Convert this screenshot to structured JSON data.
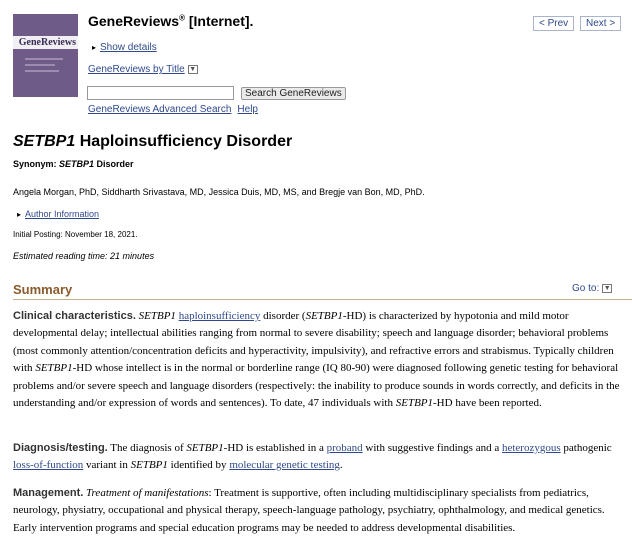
{
  "header": {
    "book_title": "GeneReviews",
    "book_title_sup": "®",
    "book_title_suffix": " [Internet].",
    "cover_title": "GeneReviews",
    "prev_label": "< Prev",
    "next_label": "Next >",
    "show_details": "Show details",
    "by_title": "GeneReviews by Title",
    "search_value": "",
    "search_button": "Search GeneReviews",
    "advanced_search": "GeneReviews Advanced Search",
    "help": "Help"
  },
  "chapter": {
    "title_gene": "SETBP1",
    "title_rest": " Haploinsufficiency Disorder",
    "synonym_label": "Synonym: ",
    "synonym_value": "SETBP1",
    "synonym_rest": " Disorder",
    "authors": "Angela Morgan, PhD, Siddharth Srivastava, MD, Jessica Duis, MD, MS, and Bregje van Bon, MD, PhD.",
    "author_info": "Author Information",
    "posting": "Initial Posting: November 18, 2021.",
    "reading_time": "Estimated reading time: 21 minutes"
  },
  "summary": {
    "heading": "Summary",
    "goto": "Go to:",
    "clinical_label": "Clinical characteristics.",
    "clinical_gene": "SETBP1",
    "clinical_link": "haploinsufficiency",
    "clinical_t1": " disorder (",
    "clinical_gene2": "SETBP1",
    "clinical_t2": "-HD) is characterized by hypotonia and mild motor developmental delay; intellectual abilities ranging from normal to severe disability; speech and language disorder; behavioral problems (most commonly attention/concentration deficits and hyperactivity, impulsivity), and refractive errors and strabismus. Typically children with ",
    "clinical_gene3": "SETBP1",
    "clinical_t3": "-HD whose intellect is in the normal or borderline range (IQ 80-90) were diagnosed following genetic testing for behavioral problems and/or severe speech and language disorders (respectively: the inability to produce sounds in words correctly, and deficits in the understanding and/or expression of words and sentences). To date, 47 individuals with ",
    "clinical_gene4": "SETBP1",
    "clinical_t4": "-HD have been reported.",
    "diag_label": "Diagnosis/testing.",
    "diag_t1": " The diagnosis of ",
    "diag_gene": "SETBP1",
    "diag_t2": "-HD is established in a ",
    "diag_link1": "proband",
    "diag_t3": " with suggestive findings and a ",
    "diag_link2": "heterozygous",
    "diag_t4": " pathogenic ",
    "diag_link3": "loss-of-function",
    "diag_t5": " variant in ",
    "diag_gene2": "SETBP1",
    "diag_t6": " identified by ",
    "diag_link4": "molecular genetic testing",
    "diag_t7": ".",
    "mgmt_label": "Management.",
    "mgmt_italic": "Treatment of manifestations",
    "mgmt_text": ": Treatment is supportive, often including multidisciplinary specialists from pediatrics, neurology, physiatry, occupational and physical therapy, speech-language pathology, psychiatry, ophthalmology, and medical genetics. Early intervention programs and special education programs may be needed to address developmental disabilities."
  }
}
